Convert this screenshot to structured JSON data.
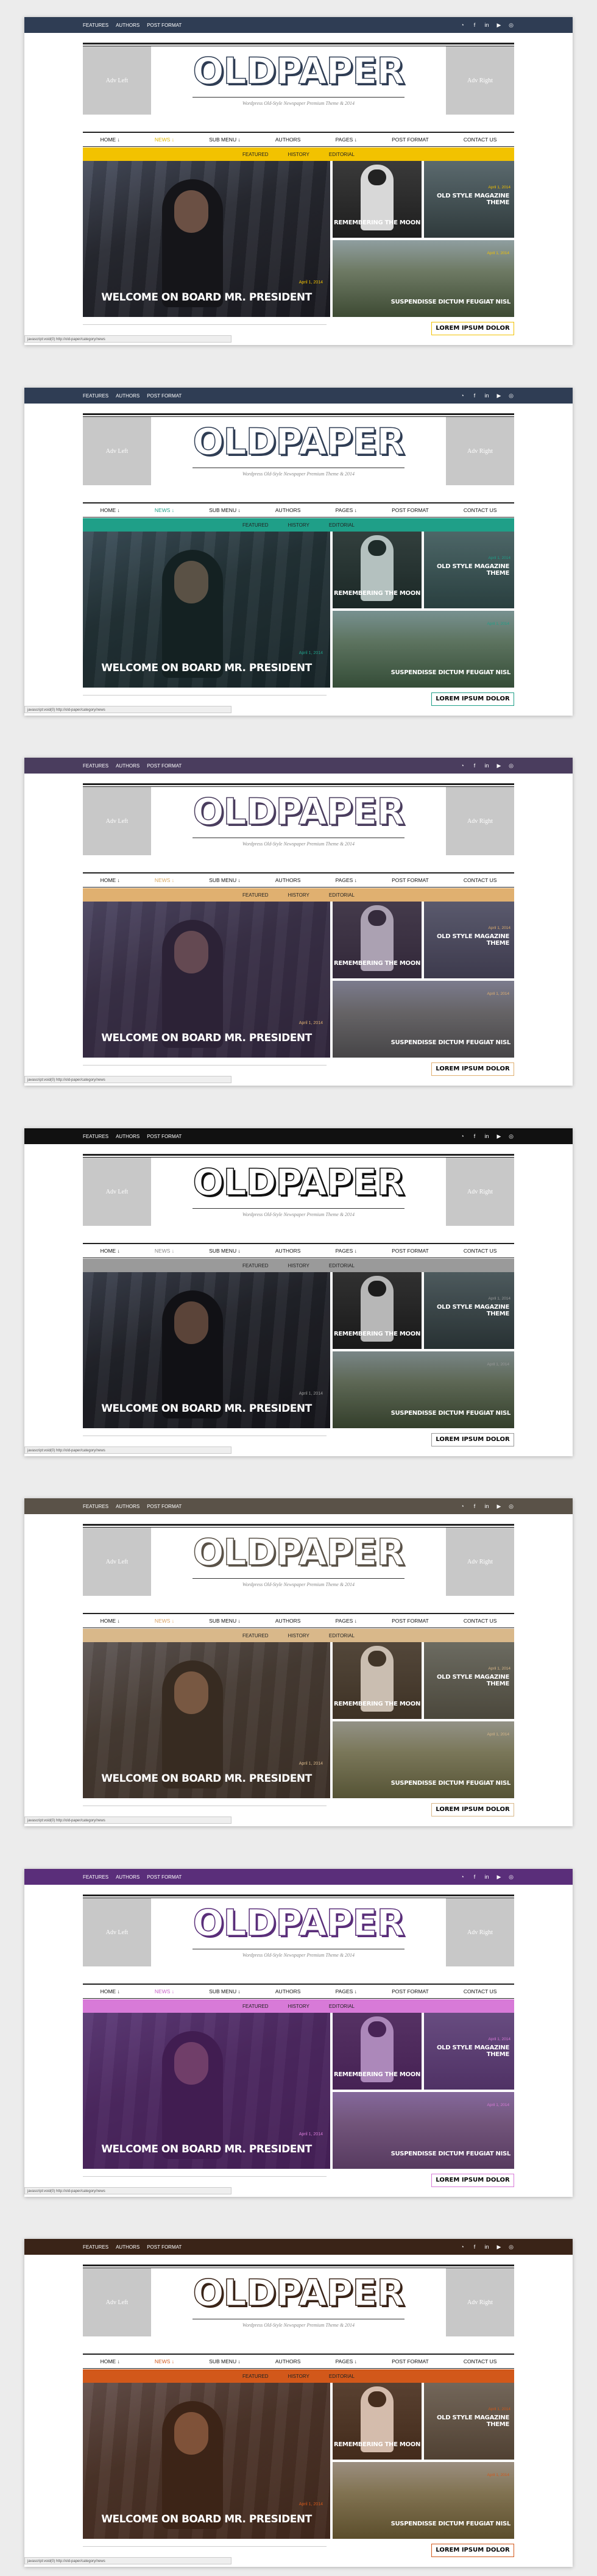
{
  "common": {
    "topnav": [
      "FEATURES",
      "AUTHORS",
      "POST FORMAT"
    ],
    "social_icons": [
      "rss-icon",
      "facebook-icon",
      "linkedin-icon",
      "youtube-icon",
      "pinterest-icon"
    ],
    "adv_left": "Adv Left",
    "adv_right": "Adv Right",
    "logo": "OLDPAPER",
    "tagline": "Wordpress Old-Style Newspaper Premium Theme & 2014",
    "mainnav": [
      "HOME ↓",
      "NEWS ↓",
      "SUB MENU ↓",
      "AUTHORS",
      "PAGES ↓",
      "POST FORMAT",
      "CONTACT US"
    ],
    "subnav": [
      "FEATURED",
      "HISTORY",
      "EDITORIAL"
    ],
    "feature_meta": "April 1, 2014",
    "feature_title": "WELCOME ON BOARD MR. PRESIDENT",
    "moon_title": "REMEMBERING THE MOON",
    "old_title": "OLD STYLE MAGAZINE THEME",
    "old_meta": "April 1, 2014",
    "susp_title": "SUSPENDISSE DICTUM FEUGIAT NISL",
    "susp_meta": "April 1, 2014",
    "lorem": "LOREM IPSUM DOLOR",
    "status": "javascript:void(0) http://old-paper/category/news"
  },
  "variants": [
    {
      "topbar": "#2f3d54",
      "accent": "#f2c200",
      "logo": "#2f3d54",
      "overlay": "rgba(0,0,0,0)",
      "news_color": "#e0b800"
    },
    {
      "topbar": "#2f3d54",
      "accent": "#1f9f88",
      "logo": "#2f3d54",
      "overlay": "rgba(18,90,80,0.18)",
      "news_color": "#1f9f88"
    },
    {
      "topbar": "#4a3d5e",
      "accent": "#e0b070",
      "logo": "#4a3d5e",
      "overlay": "rgba(90,60,110,0.35)",
      "news_color": "#d9a862"
    },
    {
      "topbar": "#111111",
      "accent": "#9a9a9a",
      "logo": "#111111",
      "overlay": "rgba(0,0,0,0.15)",
      "news_color": "#888888"
    },
    {
      "topbar": "#5a5248",
      "accent": "#d9b88a",
      "logo": "#5a5248",
      "overlay": "rgba(160,110,60,0.25)",
      "news_color": "#d9a060"
    },
    {
      "topbar": "#5a2e7a",
      "accent": "#d87ad8",
      "logo": "#5a2e7a",
      "overlay": "rgba(120,40,150,0.45)",
      "news_color": "#c860c8"
    },
    {
      "topbar": "#3a2418",
      "accent": "#d2581a",
      "logo": "#3a2418",
      "overlay": "rgba(200,90,20,0.22)",
      "news_color": "#d2581a"
    }
  ]
}
